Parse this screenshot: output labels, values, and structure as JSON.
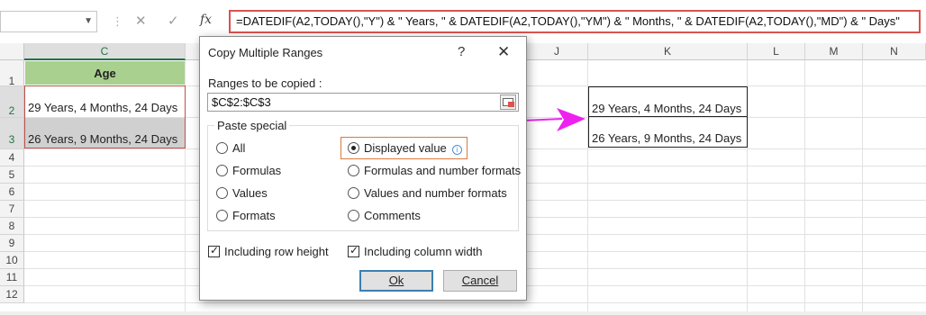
{
  "formula_bar": {
    "name_box": "",
    "cancel_glyph": "✕",
    "enter_glyph": "✓",
    "fx_label": "fx",
    "formula": "=DATEDIF(A2,TODAY(),\"Y\") & \" Years, \" & DATEDIF(A2,TODAY(),\"YM\") & \" Months, \" & DATEDIF(A2,TODAY(),\"MD\") & \" Days\""
  },
  "columns": [
    "C",
    "J",
    "K",
    "L",
    "M",
    "N"
  ],
  "rows": [
    "1",
    "2",
    "3",
    "4",
    "5",
    "6",
    "7",
    "8",
    "9",
    "10",
    "11",
    "12"
  ],
  "cells": {
    "c1": "Age",
    "c2": "29 Years, 4 Months, 24 Days",
    "c3": "26 Years, 9 Months, 24 Days",
    "k2": "29 Years, 4 Months, 24 Days",
    "k3": "26 Years, 9 Months, 24 Days"
  },
  "dialog": {
    "title": "Copy Multiple Ranges",
    "help": "?",
    "close": "✕",
    "ranges_label": "Ranges to be copied :",
    "ranges_value": "$C$2:$C$3",
    "paste_special_label": "Paste special",
    "options": {
      "all": "All",
      "formulas": "Formulas",
      "values": "Values",
      "formats": "Formats",
      "displayed_value": "Displayed value",
      "formulas_number_formats": "Formulas and number formats",
      "values_number_formats": "Values and number formats",
      "comments": "Comments"
    },
    "selected_option": "displayed_value",
    "info_glyph": "i",
    "include_row_height": "Including row height",
    "include_column_width": "Including column width",
    "ok": "Ok",
    "cancel": "Cancel"
  },
  "colors": {
    "header_fill": "#a9d08e",
    "selection_border": "#c0504d",
    "arrow": "#ee22ee",
    "formula_border": "#d9534f",
    "highlight_box": "#d97a3e"
  }
}
